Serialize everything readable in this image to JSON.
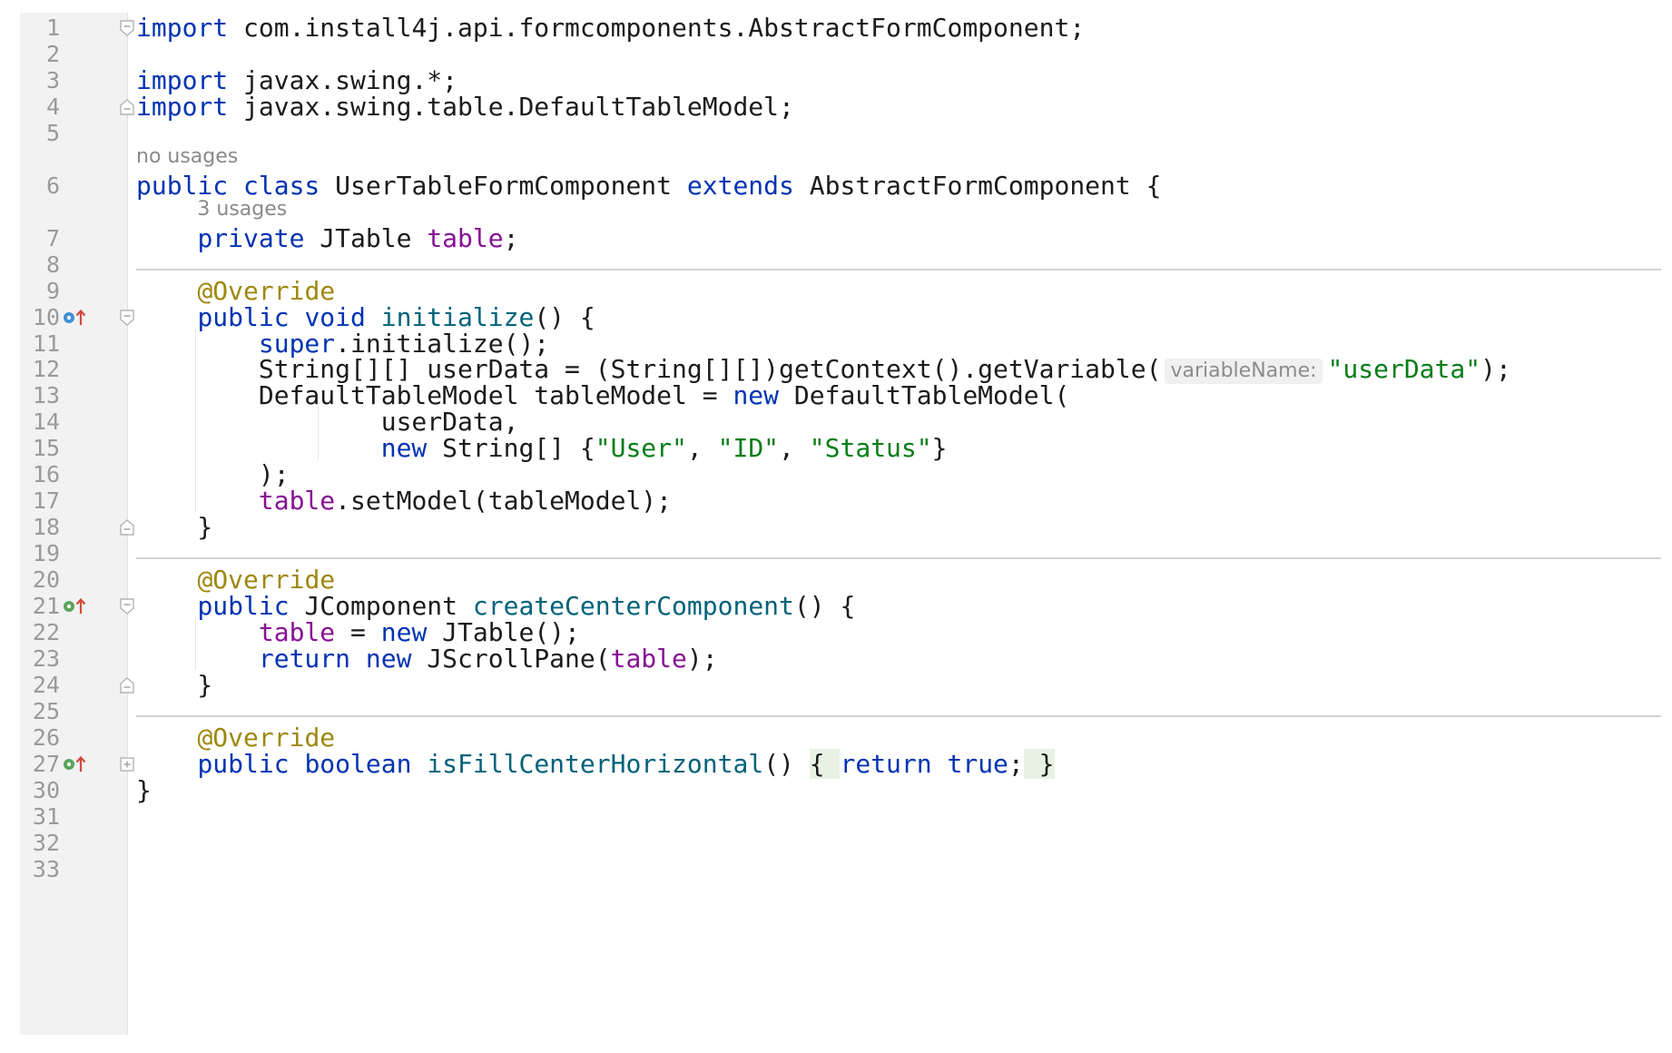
{
  "colors": {
    "keyword": "#0033b3",
    "field": "#871094",
    "method": "#00627a",
    "string": "#067d17",
    "annotation": "#9e880d",
    "plain": "#1b1b1b",
    "hint": "#8a8a8a",
    "line_number": "#9a9a9a",
    "gutter_bg": "#f2f2f2",
    "separator": "#d4d4d4",
    "override_marker": "#3d8fd1",
    "implement_marker": "#5aa35a"
  },
  "gutter": {
    "line_numbers": [
      "1",
      "2",
      "3",
      "4",
      "5",
      "6",
      "7",
      "8",
      "9",
      "10",
      "11",
      "12",
      "13",
      "14",
      "15",
      "16",
      "17",
      "18",
      "19",
      "20",
      "21",
      "22",
      "23",
      "24",
      "25",
      "26",
      "27",
      "30",
      "31",
      "32",
      "33"
    ],
    "markers": [
      {
        "line": "10",
        "icon": "override-method-icon"
      },
      {
        "line": "21",
        "icon": "implement-method-icon"
      },
      {
        "line": "27",
        "icon": "implement-method-icon"
      }
    ],
    "folds": [
      {
        "line": "1",
        "icon": "fold-start-icon"
      },
      {
        "line": "4",
        "icon": "fold-end-icon"
      },
      {
        "line": "10",
        "icon": "fold-start-icon"
      },
      {
        "line": "18",
        "icon": "fold-end-icon"
      },
      {
        "line": "21",
        "icon": "fold-start-icon"
      },
      {
        "line": "24",
        "icon": "fold-end-icon"
      },
      {
        "line": "27",
        "icon": "fold-expand-icon"
      }
    ]
  },
  "hints": {
    "class_usages": "no usages",
    "field_usages": "3 usages",
    "param_name": "variableName:"
  },
  "code": [
    [
      [
        "keyword",
        "import"
      ],
      [
        "plain",
        " com.install4j.api.formcomponents.AbstractFormComponent;"
      ]
    ],
    [],
    [
      [
        "keyword",
        "import"
      ],
      [
        "plain",
        " javax.swing.*;"
      ]
    ],
    [
      [
        "keyword",
        "import"
      ],
      [
        "plain",
        " javax.swing.table.DefaultTableModel;"
      ]
    ],
    [],
    [
      [
        "keyword",
        "public class"
      ],
      [
        "plain",
        " UserTableFormComponent "
      ],
      [
        "keyword",
        "extends"
      ],
      [
        "plain",
        " AbstractFormComponent {"
      ]
    ],
    [
      [
        "plain",
        "    "
      ],
      [
        "keyword",
        "private"
      ],
      [
        "plain",
        " JTable "
      ],
      [
        "field",
        "table"
      ],
      [
        "plain",
        ";"
      ]
    ],
    [],
    [
      [
        "plain",
        "    "
      ],
      [
        "annotation",
        "@Override"
      ]
    ],
    [
      [
        "plain",
        "    "
      ],
      [
        "keyword",
        "public void"
      ],
      [
        "plain",
        " "
      ],
      [
        "method",
        "initialize"
      ],
      [
        "plain",
        "() {"
      ]
    ],
    [
      [
        "plain",
        "        "
      ],
      [
        "keyword",
        "super"
      ],
      [
        "plain",
        ".initialize();"
      ]
    ],
    [
      [
        "plain",
        "        String[][] userData = (String[][])getContext().getVariable("
      ],
      [
        "inlay",
        "variableName:"
      ],
      [
        "string",
        "\"userData\""
      ],
      [
        "plain",
        ");"
      ]
    ],
    [
      [
        "plain",
        "        DefaultTableModel tableModel = "
      ],
      [
        "keyword",
        "new"
      ],
      [
        "plain",
        " DefaultTableModel("
      ]
    ],
    [
      [
        "plain",
        "                userData,"
      ]
    ],
    [
      [
        "plain",
        "                "
      ],
      [
        "keyword",
        "new"
      ],
      [
        "plain",
        " String[] {"
      ],
      [
        "string",
        "\"User\""
      ],
      [
        "plain",
        ", "
      ],
      [
        "string",
        "\"ID\""
      ],
      [
        "plain",
        ", "
      ],
      [
        "string",
        "\"Status\""
      ],
      [
        "plain",
        "}"
      ]
    ],
    [
      [
        "plain",
        "        );"
      ]
    ],
    [
      [
        "plain",
        "        "
      ],
      [
        "field",
        "table"
      ],
      [
        "plain",
        ".setModel(tableModel);"
      ]
    ],
    [
      [
        "plain",
        "    }"
      ]
    ],
    [],
    [
      [
        "plain",
        "    "
      ],
      [
        "annotation",
        "@Override"
      ]
    ],
    [
      [
        "plain",
        "    "
      ],
      [
        "keyword",
        "public"
      ],
      [
        "plain",
        " JComponent "
      ],
      [
        "method",
        "createCenterComponent"
      ],
      [
        "plain",
        "() {"
      ]
    ],
    [
      [
        "plain",
        "        "
      ],
      [
        "field",
        "table"
      ],
      [
        "plain",
        " = "
      ],
      [
        "keyword",
        "new"
      ],
      [
        "plain",
        " JTable();"
      ]
    ],
    [
      [
        "plain",
        "        "
      ],
      [
        "keyword",
        "return new"
      ],
      [
        "plain",
        " JScrollPane("
      ],
      [
        "field",
        "table"
      ],
      [
        "plain",
        ");"
      ]
    ],
    [
      [
        "plain",
        "    }"
      ]
    ],
    [],
    [
      [
        "plain",
        "    "
      ],
      [
        "annotation",
        "@Override"
      ]
    ],
    [
      [
        "plain",
        "    "
      ],
      [
        "keyword",
        "public boolean"
      ],
      [
        "plain",
        " "
      ],
      [
        "method",
        "isFillCenterHorizontal"
      ],
      [
        "plain",
        "()"
      ],
      [
        "plain",
        " "
      ],
      [
        "hl",
        "{ "
      ],
      [
        "keyword",
        "return true"
      ],
      [
        "plain",
        ";"
      ],
      [
        "hl",
        " }"
      ]
    ],
    [
      [
        "plain",
        "}"
      ]
    ],
    [],
    [],
    []
  ]
}
